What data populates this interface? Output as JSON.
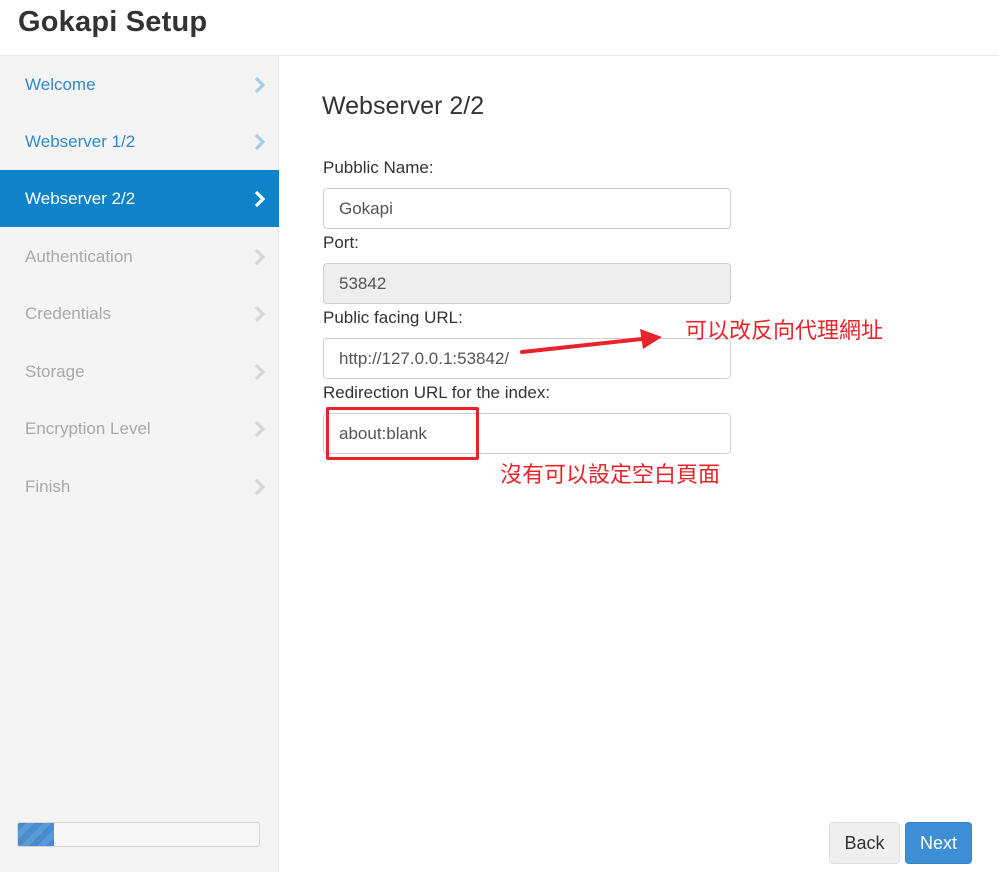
{
  "header": {
    "title": "Gokapi Setup"
  },
  "sidebar": {
    "steps": [
      {
        "label": "Welcome",
        "state": "done"
      },
      {
        "label": "Webserver 1/2",
        "state": "done"
      },
      {
        "label": "Webserver 2/2",
        "state": "active"
      },
      {
        "label": "Authentication",
        "state": "todo"
      },
      {
        "label": "Credentials",
        "state": "todo"
      },
      {
        "label": "Storage",
        "state": "todo"
      },
      {
        "label": "Encryption Level",
        "state": "todo"
      },
      {
        "label": "Finish",
        "state": "todo"
      }
    ],
    "progress_fraction": 0.15
  },
  "main": {
    "title": "Webserver 2/2",
    "fields": {
      "public_name": {
        "label": "Pubblic Name:",
        "value": "Gokapi"
      },
      "port": {
        "label": "Port:",
        "value": "53842"
      },
      "public_url": {
        "label": "Public facing URL:",
        "value": "http://127.0.0.1:53842/"
      },
      "redirect_url": {
        "label": "Redirection URL for the index:",
        "value": "about:blank"
      }
    }
  },
  "annotations": {
    "url_note": "可以改反向代理網址",
    "redirect_note": "沒有可以設定空白頁面",
    "color": "#e8232a"
  },
  "buttons": {
    "back": "Back",
    "next": "Next"
  },
  "colors": {
    "accent": "#0f83c9",
    "link": "#2e8bd0",
    "next_button": "#3d8ed4"
  }
}
